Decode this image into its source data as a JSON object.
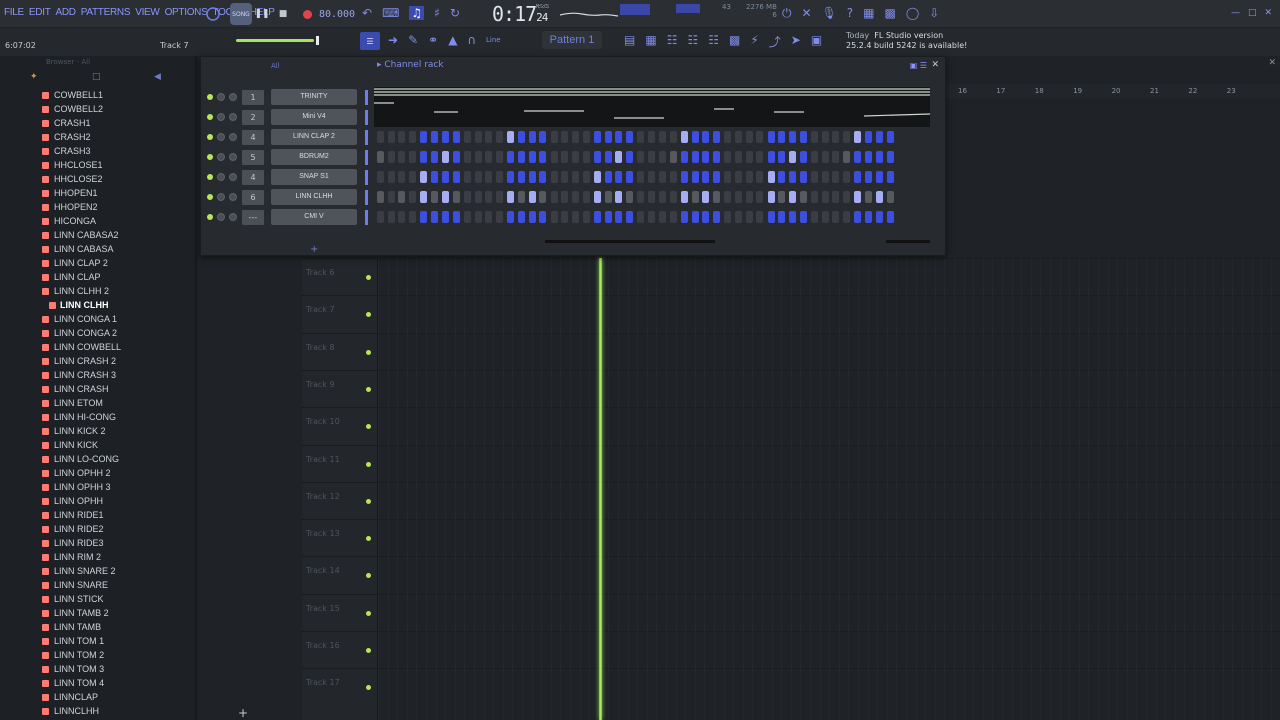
{
  "menu": [
    "FILE",
    "EDIT",
    "ADD",
    "PATTERNS",
    "VIEW",
    "OPTIONS",
    "TOOLS",
    "HELP"
  ],
  "transport": {
    "song_label": "SONG",
    "tempo": "80.000",
    "time_main": "0:17",
    "time_sub": "24",
    "time_unit": "M:S:CS",
    "cpu_value": "43",
    "memory": "2276 MB",
    "poly": "6"
  },
  "hint": {
    "time": "6:07:02",
    "track": "Track 7"
  },
  "snap_label": "Line",
  "pattern": "Pattern 1",
  "news": {
    "line1_prefix": "Today",
    "line1": "FL Studio version",
    "line2": "25.2.4 build 5242 is available!"
  },
  "browser": {
    "header": "Browser - All",
    "items": [
      "COWBELL1",
      "COWBELL2",
      "CRASH1",
      "CRASH2",
      "CRASH3",
      "HHCLOSE1",
      "HHCLOSE2",
      "HHOPEN1",
      "HHOPEN2",
      "HICONGA",
      "LINN CABASA2",
      "LINN CABASA",
      "LINN CLAP 2",
      "LINN CLAP",
      "LINN CLHH 2",
      "LINN CLHH",
      "LINN CONGA 1",
      "LINN CONGA 2",
      "LINN COWBELL",
      "LINN CRASH 2",
      "LINN CRASH 3",
      "LINN CRASH",
      "LINN ETOM",
      "LINN HI-CONG",
      "LINN KICK 2",
      "LINN KICK",
      "LINN LO-CONG",
      "LINN OPHH 2",
      "LINN OPHH 3",
      "LINN OPHH",
      "LINN RIDE1",
      "LINN RIDE2",
      "LINN RIDE3",
      "LINN RIM 2",
      "LINN SNARE 2",
      "LINN SNARE",
      "LINN STICK",
      "LINN TAMB 2",
      "LINN TAMB",
      "LINN TOM 1",
      "LINN TOM 2",
      "LINN TOM 3",
      "LINN TOM 4",
      "LINNCLAP",
      "LINNCLHH"
    ],
    "selected_index": 15
  },
  "channel_rack": {
    "title": "Channel rack",
    "filter": "All",
    "channels": [
      {
        "mixer": "1",
        "name": "TRINITY"
      },
      {
        "mixer": "2",
        "name": "Mini V4"
      },
      {
        "mixer": "4",
        "name": "LINN CLAP 2"
      },
      {
        "mixer": "5",
        "name": "BDRUM2"
      },
      {
        "mixer": "4",
        "name": "SNAP S1"
      },
      {
        "mixer": "6",
        "name": "LINN CLHH"
      },
      {
        "mixer": "---",
        "name": "CMI V"
      }
    ],
    "add_label": "+"
  },
  "playlist": {
    "ruler": [
      "16",
      "17",
      "18",
      "19",
      "20",
      "21",
      "22",
      "23"
    ],
    "tracks": [
      "Track 6",
      "Track 7",
      "Track 8",
      "Track 9",
      "Track 10",
      "Track 11",
      "Track 12",
      "Track 13",
      "Track 14",
      "Track 15",
      "Track 16",
      "Track 17"
    ],
    "add_label": "+"
  },
  "colors": {
    "accent": "#7f8ce8",
    "step_on": "#3d4fe0",
    "step_accent": "#a7adf3",
    "playhead": "#b7f06b",
    "led": "#b8e55a",
    "record": "#e3434f"
  }
}
